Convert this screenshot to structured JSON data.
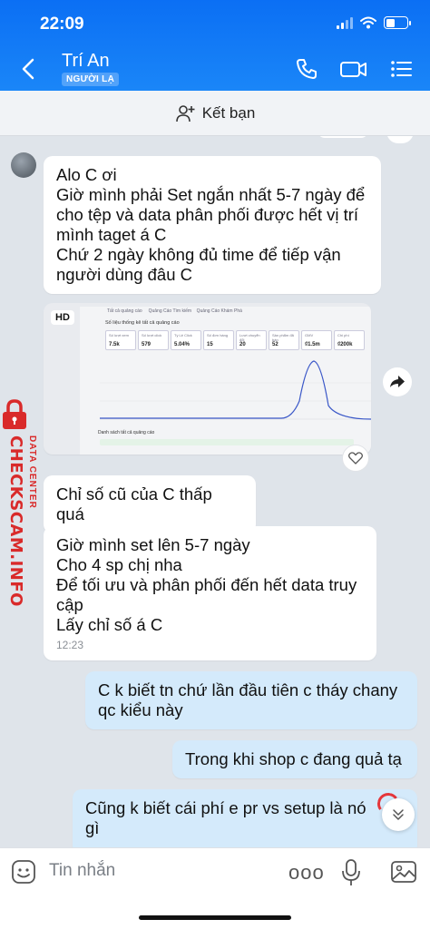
{
  "status_bar": {
    "time": "22:09"
  },
  "header": {
    "contact_name": "Trí An",
    "stranger_tag": "NGƯỜI LẠ"
  },
  "add_friend": {
    "label": "Kết bạn"
  },
  "messages": [
    {
      "lines": [
        "Alo C ơi",
        "Giờ mình phải Set ngắn nhất 5-7 ngày để",
        "cho tệp và data phân phối được hết vị trí",
        "mình taget á C",
        "Chứ 2 ngày không đủ time để tiếp vận",
        "người dùng đâu C"
      ]
    },
    {
      "lines": [
        "Chỉ số cũ của C thấp quá"
      ]
    },
    {
      "lines": [
        "Giờ mình set lên 5-7 ngày",
        "Cho 4 sp chị nha",
        "Để tối ưu và phân phối đến hết data truy",
        "cập",
        "Lấy chỉ số á C"
      ],
      "time": "12:23"
    },
    {
      "lines": [
        "C k biết tn chứ lần đầu tiên c tháy chany",
        "qc kiểu này"
      ]
    },
    {
      "lines": [
        "Trong khi shop c đang quả tạ"
      ]
    },
    {
      "lines": [
        "Cũng k biết cái phí e pr vs setup là nó",
        "gì"
      ]
    }
  ],
  "image_message": {
    "badge": "HD",
    "screenshot": {
      "section_title": "Số liệu thống kê tất cả quảng cáo",
      "list_title": "Danh sách tất cả quảng cáo",
      "metric_values": [
        "7.5k",
        "579",
        "5.04%",
        "15",
        "20",
        "52",
        "₫1.5m",
        "₫200k"
      ]
    }
  },
  "watermark": {
    "brand": "CHECKSCAM.INFO",
    "tagline": "DATA CENTER"
  },
  "input": {
    "placeholder": "Tin nhắn",
    "more": "ooo"
  },
  "colors": {
    "header": "#1a86f8",
    "incoming": "#ffffff",
    "outgoing": "#d4eafb",
    "watermark": "#d92a2a"
  }
}
